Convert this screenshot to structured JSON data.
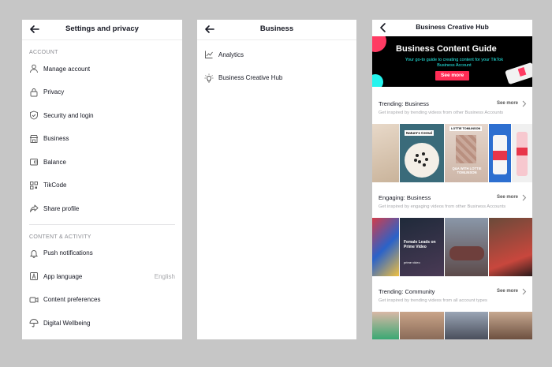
{
  "settings": {
    "title": "Settings and privacy",
    "account_header": "ACCOUNT",
    "account_items": [
      {
        "label": "Manage account",
        "icon": "person-icon"
      },
      {
        "label": "Privacy",
        "icon": "lock-icon"
      },
      {
        "label": "Security and login",
        "icon": "shield-icon"
      },
      {
        "label": "Business",
        "icon": "store-icon"
      },
      {
        "label": "Balance",
        "icon": "wallet-icon"
      },
      {
        "label": "TikCode",
        "icon": "qr-code-icon"
      },
      {
        "label": "Share profile",
        "icon": "share-icon"
      }
    ],
    "content_header": "CONTENT & ACTIVITY",
    "content_items": [
      {
        "label": "Push notifications",
        "icon": "bell-icon",
        "value": ""
      },
      {
        "label": "App language",
        "icon": "language-icon",
        "value": "English"
      },
      {
        "label": "Content preferences",
        "icon": "video-icon",
        "value": ""
      },
      {
        "label": "Digital Wellbeing",
        "icon": "umbrella-icon",
        "value": ""
      }
    ]
  },
  "business": {
    "title": "Business",
    "items": [
      {
        "label": "Analytics",
        "icon": "analytics-icon"
      },
      {
        "label": "Business Creative Hub",
        "icon": "lightbulb-icon"
      }
    ]
  },
  "hub": {
    "title": "Business Creative Hub",
    "banner": {
      "title": "Business Content Guide",
      "subtitle": "Your go-to guide to creating content for your TikTok Business Account",
      "button": "See more"
    },
    "sections": [
      {
        "title": "Trending: Business",
        "see_more": "See more",
        "desc": "Get inspired by trending videos from other Business Accounts",
        "thumb_texts": [
          "Nature's Cereal",
          "LOTTIE TOMLINSON",
          "Q&A WITH LOTTIE TOMLINSON"
        ]
      },
      {
        "title": "Engaging: Business",
        "see_more": "See more",
        "desc": "Get inspired by engaging videos from other Business Accounts",
        "thumb_texts": [
          "Female Leads on Prime Video",
          "prime video"
        ]
      },
      {
        "title": "Trending: Community",
        "see_more": "See more",
        "desc": "Get inspired by trending videos from all account types",
        "thumb_texts": []
      }
    ]
  },
  "colors": {
    "background": "#c6c6c6",
    "brand_red": "#fe2c55",
    "brand_cyan": "#25f4ee",
    "text_primary": "#161823",
    "text_secondary": "#8a8b91"
  }
}
